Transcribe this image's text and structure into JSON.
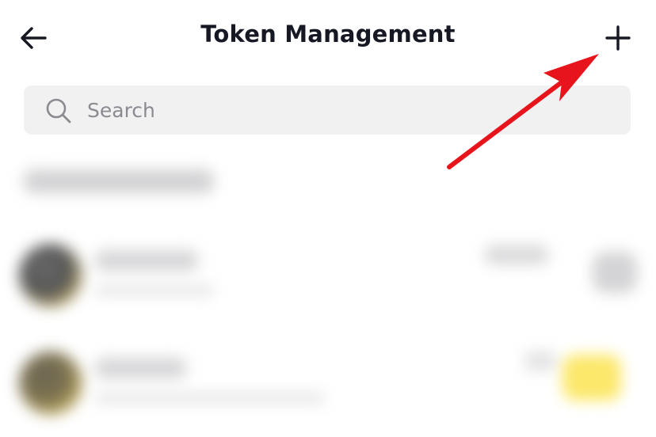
{
  "header": {
    "title": "Token Management",
    "back_icon": "arrow-left-icon",
    "add_icon": "plus-icon"
  },
  "search": {
    "placeholder": "Search",
    "value": "",
    "icon": "search-icon"
  },
  "colors": {
    "title_text": "#161823",
    "search_bg": "#f1f1f2",
    "placeholder_text": "#8a8b91",
    "annotation_arrow": "#e8141c",
    "highlight_yellow": "#fce86a"
  },
  "annotation": {
    "type": "arrow",
    "points_to": "add-button"
  }
}
